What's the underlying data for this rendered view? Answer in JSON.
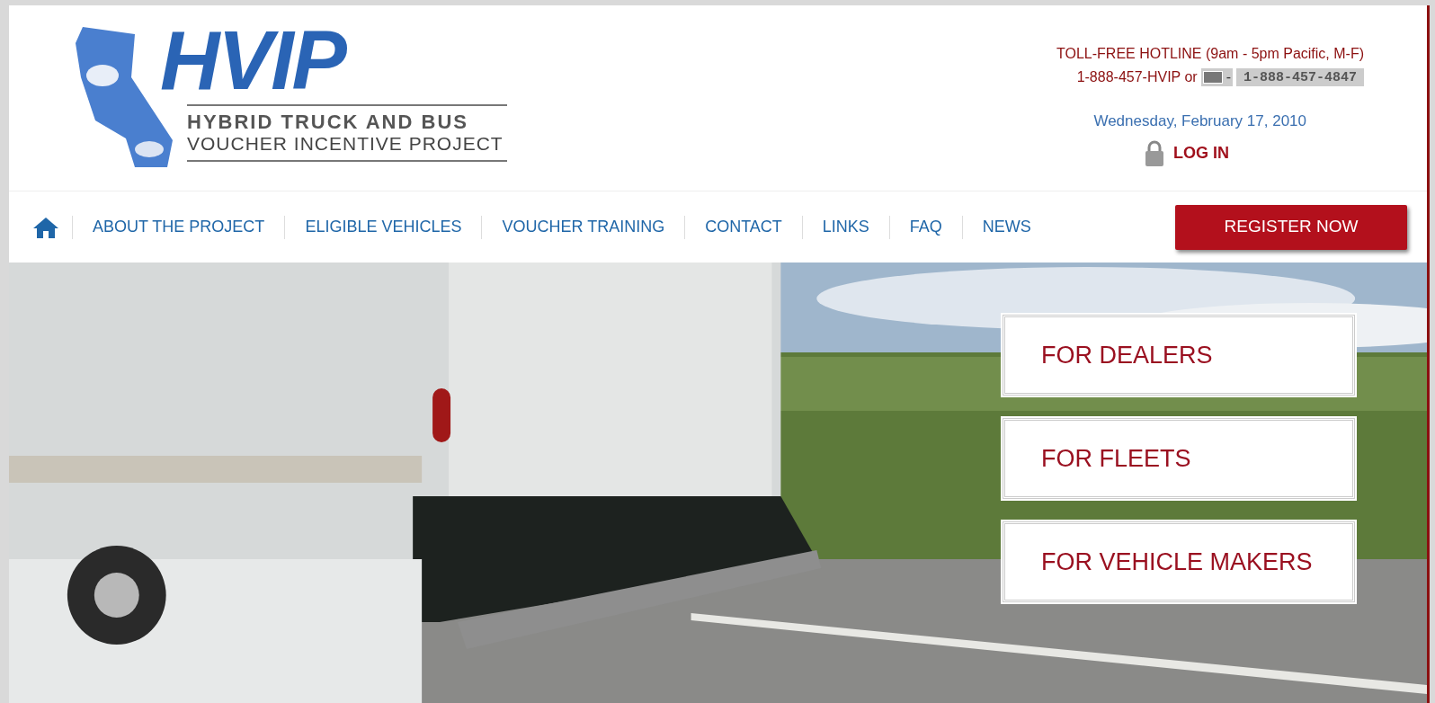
{
  "logo": {
    "title": "HVIP",
    "line_1": "HYBRID TRUCK AND BUS",
    "line_2": "VOUCHER INCENTIVE PROJECT"
  },
  "hotline": {
    "label": "TOLL-FREE HOTLINE (9am - 5pm Pacific, M-F)",
    "phone_text": "1-888-457-HVIP or",
    "separator": "-",
    "phone_number": "1-888-457-4847"
  },
  "date": "Wednesday, February 17, 2010",
  "login": "LOG IN",
  "nav": [
    {
      "label": "ABOUT THE PROJECT"
    },
    {
      "label": "ELIGIBLE VEHICLES"
    },
    {
      "label": "VOUCHER TRAINING"
    },
    {
      "label": "CONTACT"
    },
    {
      "label": "LINKS"
    },
    {
      "label": "FAQ"
    },
    {
      "label": "NEWS"
    }
  ],
  "register_button": "REGISTER NOW",
  "hero": {
    "kind": "picture",
    "buttons": [
      {
        "label": "FOR DEALERS"
      },
      {
        "label": "FOR FLEETS"
      },
      {
        "label": "FOR VEHICLE MAKERS"
      }
    ]
  }
}
